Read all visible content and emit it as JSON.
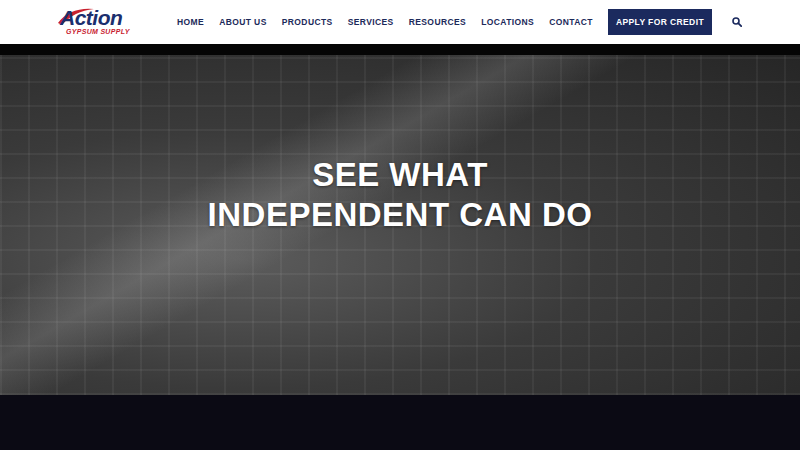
{
  "logo": {
    "name": "Action",
    "tagline": "GYPSUM SUPPLY"
  },
  "nav": {
    "items": [
      {
        "label": "HOME"
      },
      {
        "label": "ABOUT US"
      },
      {
        "label": "PRODUCTS"
      },
      {
        "label": "SERVICES"
      },
      {
        "label": "RESOURCES"
      },
      {
        "label": "LOCATIONS"
      },
      {
        "label": "CONTACT"
      }
    ],
    "cta": "APPLY FOR CREDIT"
  },
  "hero": {
    "headline_lines": [
      "SEE WHAT",
      "INDEPENDENT CAN DO"
    ]
  }
}
